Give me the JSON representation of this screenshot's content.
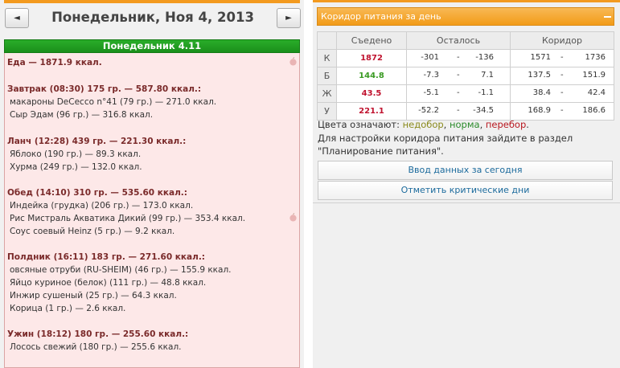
{
  "nav": {
    "prev_label": "◄",
    "next_label": "►",
    "date_title": "Понедельник, Ноя 4, 2013"
  },
  "day": {
    "header": "Понедельник 4.11",
    "lines": [
      {
        "text": "Еда — 1871.9 ккал.",
        "kind": "bold"
      },
      {
        "text": "Завтрак (08:30) 175 гр. — 587.80 ккал.:",
        "kind": "bold"
      },
      {
        "text": "макароны DeCecco n°41 (79 гр.) — 271.0 ккал.",
        "kind": "item"
      },
      {
        "text": "Сыр Эдам (96 гр.) — 316.8 ккал.",
        "kind": "item"
      },
      {
        "text": "Ланч (12:28) 439 гр. — 221.30 ккал.:",
        "kind": "bold"
      },
      {
        "text": "Яблоко (190 гр.) — 89.3 ккал.",
        "kind": "item"
      },
      {
        "text": "Хурма (249 гр.) — 132.0 ккал.",
        "kind": "item"
      },
      {
        "text": "Обед (14:10) 310 гр. — 535.60 ккал.:",
        "kind": "bold"
      },
      {
        "text": "Индейка (грудка) (206 гр.) — 173.0 ккал.",
        "kind": "item"
      },
      {
        "text": "Рис Мистраль Акватика Дикий (99 гр.) — 353.4 ккал.",
        "kind": "item"
      },
      {
        "text": "Соус соевый Heinz (5 гр.) — 9.2 ккал.",
        "kind": "item"
      },
      {
        "text": "Полдник (16:11) 183 гр. — 271.60 ккал.:",
        "kind": "bold"
      },
      {
        "text": "овсяные отруби (RU-SHEIM) (46 гр.) — 155.9 ккал.",
        "kind": "item"
      },
      {
        "text": "Яйцо куриное (белок) (111 гр.) — 48.8 ккал.",
        "kind": "item"
      },
      {
        "text": "Инжир сушеный (25 гр.) — 64.3 ккал.",
        "kind": "item"
      },
      {
        "text": "Корица (1 гр.) — 2.6 ккал.",
        "kind": "item"
      },
      {
        "text": "Ужин (18:12) 180 гр. — 255.60 ккал.:",
        "kind": "bold"
      },
      {
        "text": "Лосось свежий (180 гр.) — 255.6 ккал.",
        "kind": "item"
      }
    ]
  },
  "panel": {
    "title": "Коридор питания за день",
    "collapse_label": "—",
    "columns": [
      "Съедено",
      "Осталось",
      "Коридор"
    ],
    "rows": [
      {
        "label": "К",
        "eaten": "1872",
        "eaten_color": "red",
        "rem_a": "-301",
        "rem_b": "-136",
        "cor_a": "1571",
        "cor_b": "1736"
      },
      {
        "label": "Б",
        "eaten": "144.8",
        "eaten_color": "green",
        "rem_a": "-7.3",
        "rem_b": "7.1",
        "cor_a": "137.5",
        "cor_b": "151.9"
      },
      {
        "label": "Ж",
        "eaten": "43.5",
        "eaten_color": "red",
        "rem_a": "-5.1",
        "rem_b": "-1.1",
        "cor_a": "38.4",
        "cor_b": "42.4"
      },
      {
        "label": "У",
        "eaten": "221.1",
        "eaten_color": "red",
        "rem_a": "-52.2",
        "rem_b": "-34.5",
        "cor_a": "168.9",
        "cor_b": "186.6"
      }
    ],
    "dash": "-",
    "legend_prefix": "Цвета означают: ",
    "legend_under": "недобор",
    "legend_norm": "норма",
    "legend_over": "перебор",
    "legend_sep1": ", ",
    "legend_sep2": ", ",
    "legend_end": ".",
    "note": "Для настройки коридора питания зайдите в раздел \"Планирование питания\".",
    "button_today": "Ввод данных за сегодня",
    "button_critical": "Отметить критические дни",
    "colors": {
      "accent": "#f39a1f",
      "green_header": "#1f9a1f",
      "red_value": "#c0132f",
      "green_value": "#3a9a23",
      "link": "#1b6a9c"
    }
  }
}
